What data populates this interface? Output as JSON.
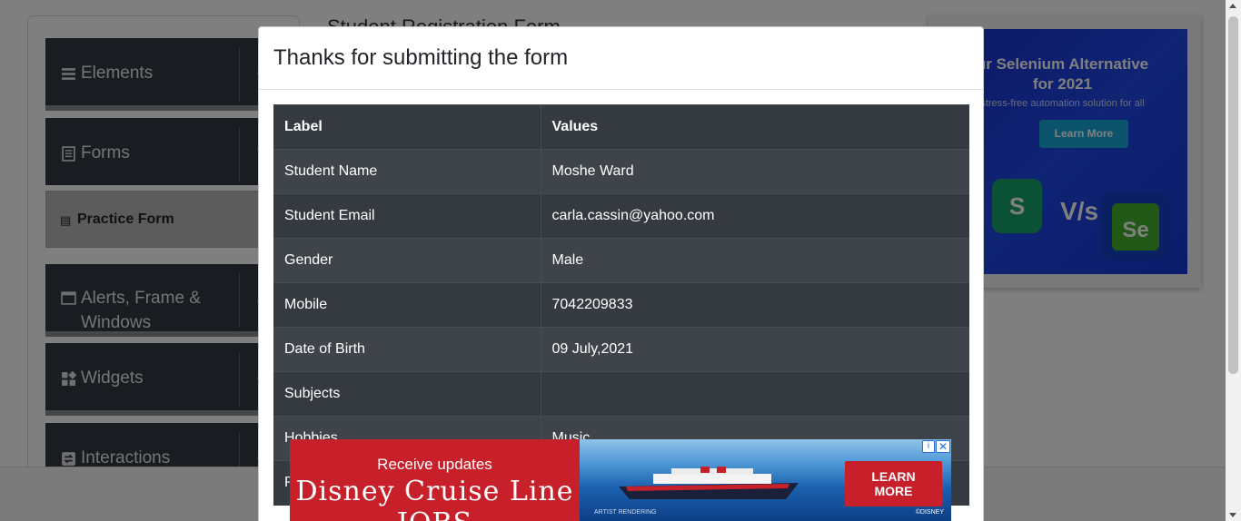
{
  "page": {
    "form_title": "Student Registration Form"
  },
  "sidebar": {
    "groups": [
      {
        "label": "Elements",
        "icon": "menu-icon"
      },
      {
        "label": "Forms",
        "icon": "document-icon"
      },
      {
        "label": "Alerts, Frame & Windows",
        "label_line1": "Alerts, Frame &",
        "label_line2": "Windows",
        "icon": "window-icon"
      },
      {
        "label": "Widgets",
        "icon": "widgets-icon"
      },
      {
        "label": "Interactions",
        "icon": "interactions-icon"
      }
    ],
    "active_item": {
      "label": "Practice Form",
      "icon": "form-icon"
    }
  },
  "right_ad": {
    "headline_line1": "ur Selenium Alternative",
    "headline_line2": "for 2021",
    "subtext": "stress-free automation solution for all",
    "button": "Learn More",
    "badge_left": "S",
    "versus": "V/s",
    "badge_right": "Se"
  },
  "modal": {
    "title": "Thanks for submitting the form",
    "table": {
      "headers": [
        "Label",
        "Values"
      ],
      "rows": [
        {
          "label": "Student Name",
          "value": "Moshe Ward"
        },
        {
          "label": "Student Email",
          "value": "carla.cassin@yahoo.com"
        },
        {
          "label": "Gender",
          "value": "Male"
        },
        {
          "label": "Mobile",
          "value": "7042209833"
        },
        {
          "label": "Date of Birth",
          "value": "09 July,2021"
        },
        {
          "label": "Subjects",
          "value": ""
        },
        {
          "label": "Hobbies",
          "value": "Music"
        },
        {
          "label": "P",
          "value": ""
        }
      ]
    }
  },
  "bottom_ad": {
    "line1": "Receive updates",
    "line2": "Disney Cruise Line JOBS",
    "button_line1": "LEARN",
    "button_line2": "MORE",
    "caption": "ARTIST RENDERING",
    "copyright": "©DISNEY",
    "adchoices": "i",
    "close": "✕"
  },
  "colors": {
    "overlay": "rgba(0,0,0,0.5)",
    "table_dark": "#343a40",
    "table_striped": "#3e444a",
    "sidebar_group": "#333b42",
    "ad_red": "#c8202a"
  }
}
